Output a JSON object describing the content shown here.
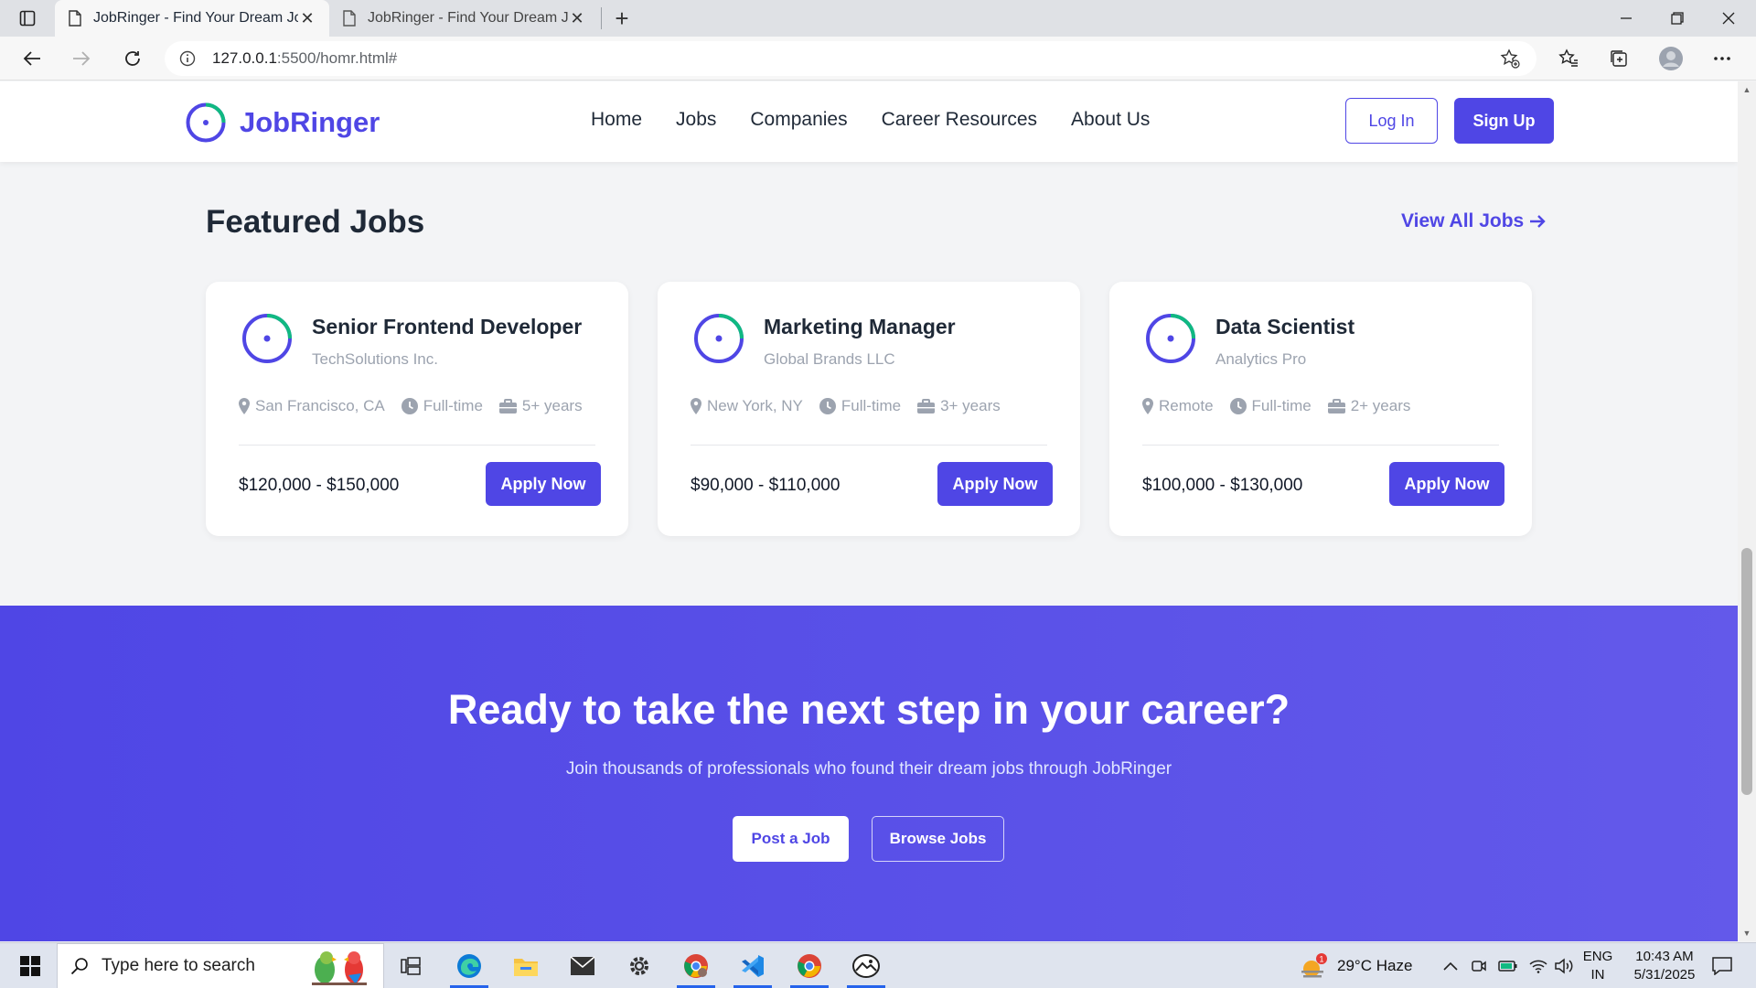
{
  "browser": {
    "tabs": [
      {
        "title": "JobRinger - Find Your Dream Job",
        "active": true
      },
      {
        "title": "JobRinger - Find Your Dream Job",
        "active": false
      }
    ],
    "address": {
      "host": "127.0.0.1",
      "path": ":5500/homr.html#"
    }
  },
  "site": {
    "brand": "JobRinger",
    "nav": [
      "Home",
      "Jobs",
      "Companies",
      "Career Resources",
      "About Us"
    ],
    "login_label": "Log In",
    "signup_label": "Sign Up",
    "accent": "#4f46e5",
    "accent_green": "#10b981"
  },
  "featured": {
    "title": "Featured Jobs",
    "view_all": "View All Jobs",
    "jobs": [
      {
        "title": "Senior Frontend Developer",
        "company": "TechSolutions Inc.",
        "location": "San Francisco, CA",
        "type": "Full-time",
        "experience": "5+ years",
        "salary": "$120,000 - $150,000",
        "apply": "Apply Now"
      },
      {
        "title": "Marketing Manager",
        "company": "Global Brands LLC",
        "location": "New York, NY",
        "type": "Full-time",
        "experience": "3+ years",
        "salary": "$90,000 - $110,000",
        "apply": "Apply Now"
      },
      {
        "title": "Data Scientist",
        "company": "Analytics Pro",
        "location": "Remote",
        "type": "Full-time",
        "experience": "2+ years",
        "salary": "$100,000 - $130,000",
        "apply": "Apply Now"
      }
    ]
  },
  "cta": {
    "title": "Ready to take the next step in your career?",
    "subtitle": "Join thousands of professionals who found their dream jobs through JobRinger",
    "post_label": "Post a Job",
    "browse_label": "Browse Jobs"
  },
  "taskbar": {
    "search_placeholder": "Type here to search",
    "weather": "29°C  Haze",
    "weather_badge": "1",
    "lang_top": "ENG",
    "lang_bottom": "IN",
    "time": "10:43 AM",
    "date": "5/31/2025"
  }
}
